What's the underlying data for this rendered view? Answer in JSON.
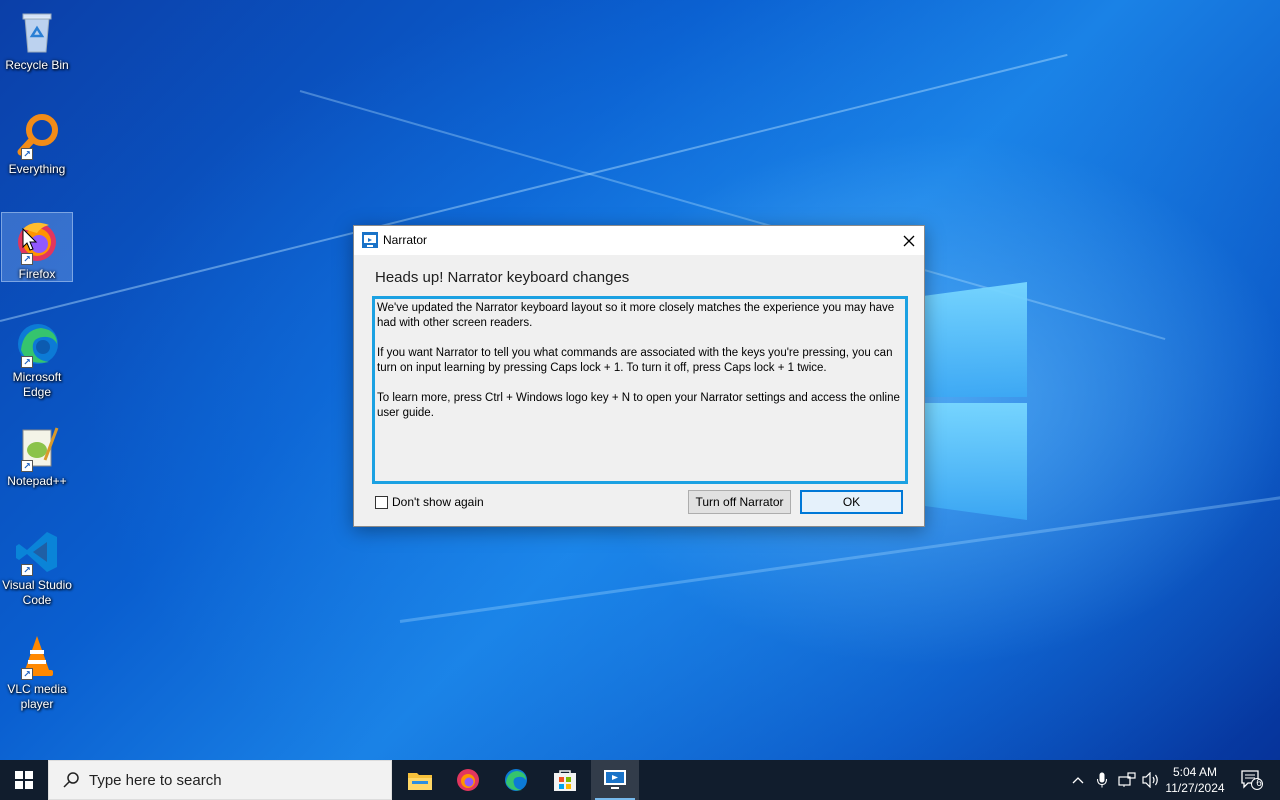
{
  "desktop": {
    "icons": [
      {
        "label": "Recycle Bin",
        "icon": "recycle-bin-icon"
      },
      {
        "label": "Everything",
        "icon": "everything-search-icon"
      },
      {
        "label": "Firefox",
        "icon": "firefox-icon"
      },
      {
        "label": "Microsoft Edge",
        "icon": "edge-icon"
      },
      {
        "label": "Notepad++",
        "icon": "notepadpp-icon"
      },
      {
        "label": "Visual Studio Code",
        "icon": "vscode-icon"
      },
      {
        "label": "VLC media player",
        "icon": "vlc-icon"
      }
    ]
  },
  "dialog": {
    "title": "Narrator",
    "heading": "Heads up! Narrator keyboard changes",
    "paragraphs": [
      "We've updated the Narrator keyboard layout so it more closely matches the experience you may have had with other screen readers.",
      "If you want Narrator to tell you what commands are associated with the keys you're pressing, you can turn on input learning by pressing Caps lock + 1. To turn it off, press Caps lock + 1 twice.",
      "To learn more, press Ctrl + Windows logo key + N to open your Narrator settings and access the online user guide."
    ],
    "checkbox_label": "Don't show again",
    "checkbox_checked": false,
    "turn_off_label": "Turn off Narrator",
    "ok_label": "OK"
  },
  "taskbar": {
    "search_placeholder": "Type here to search",
    "pinned": [
      "file-explorer-icon",
      "firefox-icon",
      "edge-icon",
      "store-icon",
      "narrator-icon"
    ],
    "time": "5:04 AM",
    "date": "11/27/2024",
    "notification_count": "6"
  },
  "colors": {
    "accent": "#1ba1e2",
    "taskbar": "#111d2d",
    "ok_border": "#0078d7"
  }
}
